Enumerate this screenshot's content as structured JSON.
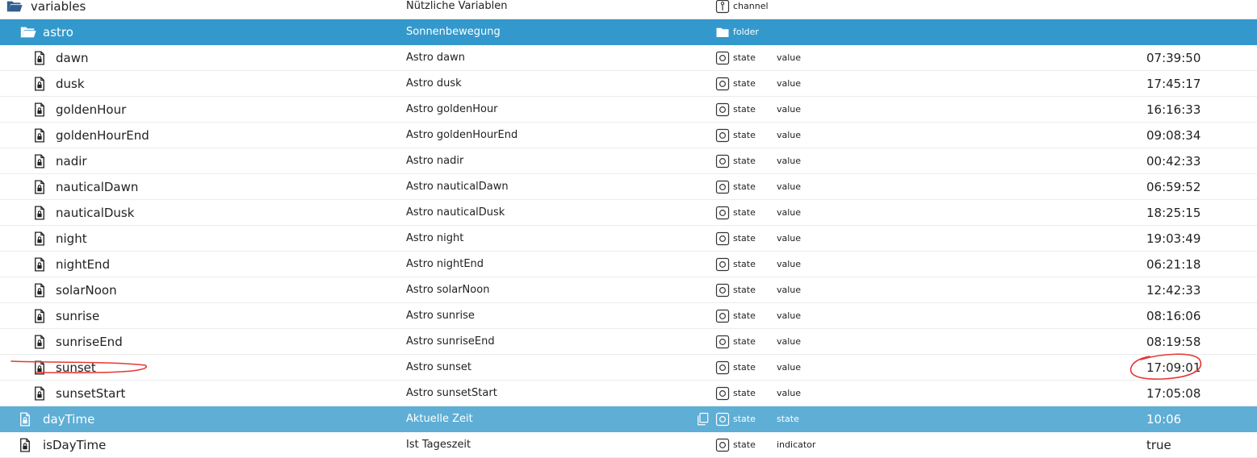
{
  "colors": {
    "selected_dark": "#3399cc",
    "selected_light": "#5eaed6",
    "annotation": "#e53935",
    "folder_icon": "#2f5f8f"
  },
  "rows": [
    {
      "id": "variables",
      "name": "variables",
      "desc": "Nützliche Variablen",
      "type_icon": "channel-icon",
      "type": "channel",
      "role": "",
      "value": "",
      "level": 0,
      "icon": "folder-open-icon",
      "style": ""
    },
    {
      "id": "astro",
      "name": "astro",
      "desc": "Sonnenbewegung",
      "type_icon": "folder-icon",
      "type": "folder",
      "role": "",
      "value": "",
      "level": 1,
      "icon": "folder-open-icon",
      "style": "sel-dark"
    },
    {
      "id": "dawn",
      "name": "dawn",
      "desc": "Astro dawn",
      "type_icon": "state-icon",
      "type": "state",
      "role": "value",
      "value": "07:39:50",
      "level": 2,
      "icon": "file-lock-icon",
      "style": ""
    },
    {
      "id": "dusk",
      "name": "dusk",
      "desc": "Astro dusk",
      "type_icon": "state-icon",
      "type": "state",
      "role": "value",
      "value": "17:45:17",
      "level": 2,
      "icon": "file-lock-icon",
      "style": ""
    },
    {
      "id": "goldenHour",
      "name": "goldenHour",
      "desc": "Astro goldenHour",
      "type_icon": "state-icon",
      "type": "state",
      "role": "value",
      "value": "16:16:33",
      "level": 2,
      "icon": "file-lock-icon",
      "style": ""
    },
    {
      "id": "goldenHourEnd",
      "name": "goldenHourEnd",
      "desc": "Astro goldenHourEnd",
      "type_icon": "state-icon",
      "type": "state",
      "role": "value",
      "value": "09:08:34",
      "level": 2,
      "icon": "file-lock-icon",
      "style": ""
    },
    {
      "id": "nadir",
      "name": "nadir",
      "desc": "Astro nadir",
      "type_icon": "state-icon",
      "type": "state",
      "role": "value",
      "value": "00:42:33",
      "level": 2,
      "icon": "file-lock-icon",
      "style": ""
    },
    {
      "id": "nauticalDawn",
      "name": "nauticalDawn",
      "desc": "Astro nauticalDawn",
      "type_icon": "state-icon",
      "type": "state",
      "role": "value",
      "value": "06:59:52",
      "level": 2,
      "icon": "file-lock-icon",
      "style": ""
    },
    {
      "id": "nauticalDusk",
      "name": "nauticalDusk",
      "desc": "Astro nauticalDusk",
      "type_icon": "state-icon",
      "type": "state",
      "role": "value",
      "value": "18:25:15",
      "level": 2,
      "icon": "file-lock-icon",
      "style": ""
    },
    {
      "id": "night",
      "name": "night",
      "desc": "Astro night",
      "type_icon": "state-icon",
      "type": "state",
      "role": "value",
      "value": "19:03:49",
      "level": 2,
      "icon": "file-lock-icon",
      "style": ""
    },
    {
      "id": "nightEnd",
      "name": "nightEnd",
      "desc": "Astro nightEnd",
      "type_icon": "state-icon",
      "type": "state",
      "role": "value",
      "value": "06:21:18",
      "level": 2,
      "icon": "file-lock-icon",
      "style": ""
    },
    {
      "id": "solarNoon",
      "name": "solarNoon",
      "desc": "Astro solarNoon",
      "type_icon": "state-icon",
      "type": "state",
      "role": "value",
      "value": "12:42:33",
      "level": 2,
      "icon": "file-lock-icon",
      "style": ""
    },
    {
      "id": "sunrise",
      "name": "sunrise",
      "desc": "Astro sunrise",
      "type_icon": "state-icon",
      "type": "state",
      "role": "value",
      "value": "08:16:06",
      "level": 2,
      "icon": "file-lock-icon",
      "style": ""
    },
    {
      "id": "sunriseEnd",
      "name": "sunriseEnd",
      "desc": "Astro sunriseEnd",
      "type_icon": "state-icon",
      "type": "state",
      "role": "value",
      "value": "08:19:58",
      "level": 2,
      "icon": "file-lock-icon",
      "style": ""
    },
    {
      "id": "sunset",
      "name": "sunset",
      "desc": "Astro sunset",
      "type_icon": "state-icon",
      "type": "state",
      "role": "value",
      "value": "17:09:01",
      "level": 2,
      "icon": "file-lock-icon",
      "style": ""
    },
    {
      "id": "sunsetStart",
      "name": "sunsetStart",
      "desc": "Astro sunsetStart",
      "type_icon": "state-icon",
      "type": "state",
      "role": "value",
      "value": "17:05:08",
      "level": 2,
      "icon": "file-lock-icon",
      "style": ""
    },
    {
      "id": "dayTime",
      "name": "dayTime",
      "desc": "Aktuelle Zeit",
      "type_icon": "state-icon",
      "type": "state",
      "role": "state",
      "value": "10:06",
      "level": 1,
      "icon": "file-lock-icon",
      "style": "sel-light",
      "copy_icon": "copy-icon"
    },
    {
      "id": "isDayTime",
      "name": "isDayTime",
      "desc": "Ist Tageszeit",
      "type_icon": "state-icon",
      "type": "state",
      "role": "indicator",
      "value": "true",
      "level": 1,
      "icon": "file-lock-icon",
      "style": ""
    }
  ]
}
